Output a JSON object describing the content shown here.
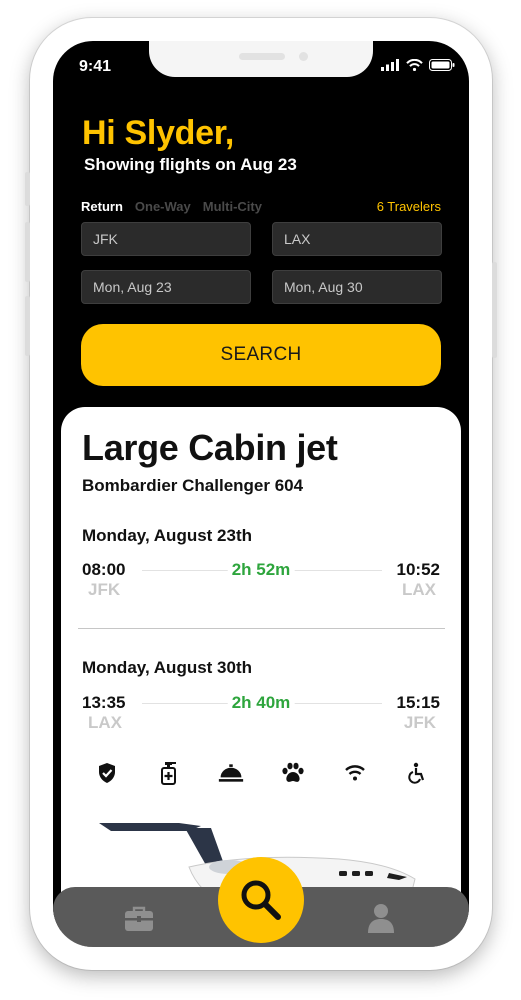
{
  "status_bar": {
    "time": "9:41"
  },
  "header": {
    "greeting": "Hi Slyder,",
    "subtitle": "Showing flights on Aug 23"
  },
  "trip_types": [
    "Return",
    "One-Way",
    "Multi-City"
  ],
  "selected_trip_type": "Return",
  "travelers": "6 Travelers",
  "search_form": {
    "from": "JFK",
    "to": "LAX",
    "depart_date": "Mon, Aug 23",
    "return_date": "Mon, Aug 30"
  },
  "search_button": "SEARCH",
  "result": {
    "category": "Large Cabin jet",
    "aircraft": "Bombardier Challenger 604",
    "legs": [
      {
        "date": "Monday, August 23th",
        "dep_time": "08:00",
        "dep_code": "JFK",
        "duration": "2h 52m",
        "arr_time": "10:52",
        "arr_code": "LAX"
      },
      {
        "date": "Monday, August 30th",
        "dep_time": "13:35",
        "dep_code": "LAX",
        "duration": "2h 40m",
        "arr_time": "15:15",
        "arr_code": "JFK"
      }
    ],
    "amenities": [
      "shield-icon",
      "sanitizer-icon",
      "catering-icon",
      "pet-icon",
      "wifi-icon",
      "accessibility-icon"
    ]
  },
  "bottom_nav": [
    "briefcase-icon",
    "search-icon",
    "profile-icon"
  ],
  "colors": {
    "accent": "#ffc300",
    "duration": "#2ea53d",
    "background": "#000000",
    "nav": "#5a5a5a"
  }
}
